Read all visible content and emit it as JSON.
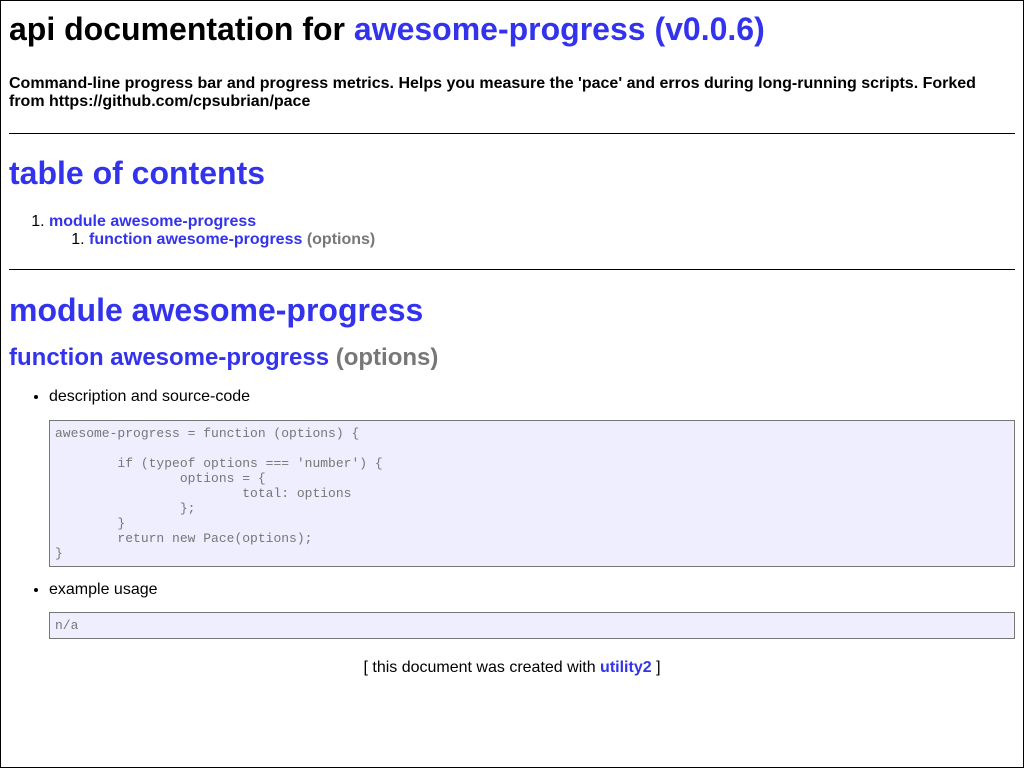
{
  "header": {
    "title_prefix": "api documentation for",
    "title_link": "awesome-progress (v0.0.6)",
    "description": "Command-line progress bar and progress metrics. Helps you measure the 'pace' and erros during long-running scripts. Forked from https://github.com/cpsubrian/pace"
  },
  "toc": {
    "title": "table of contents",
    "items": [
      {
        "label": "module awesome-progress",
        "children": [
          {
            "label": "function awesome-progress",
            "params": "(options)"
          }
        ]
      }
    ]
  },
  "module": {
    "title": "module awesome-progress",
    "function": {
      "title": "function awesome-progress",
      "params": "(options)",
      "source_label": "description and source-code",
      "source_code": "awesome-progress = function (options) {\n\n\tif (typeof options === 'number') {\n\t\toptions = {\n\t\t\ttotal: options\n\t\t};\n\t}\n\treturn new Pace(options);\n}",
      "example_label": "example usage",
      "example_code": "n/a"
    }
  },
  "footer": {
    "open": "[ this document was created with",
    "link": "utility2",
    "close": "]"
  },
  "colors": {
    "link": "#3333ee",
    "muted": "#777777",
    "code_bg": "#eeeeff"
  }
}
